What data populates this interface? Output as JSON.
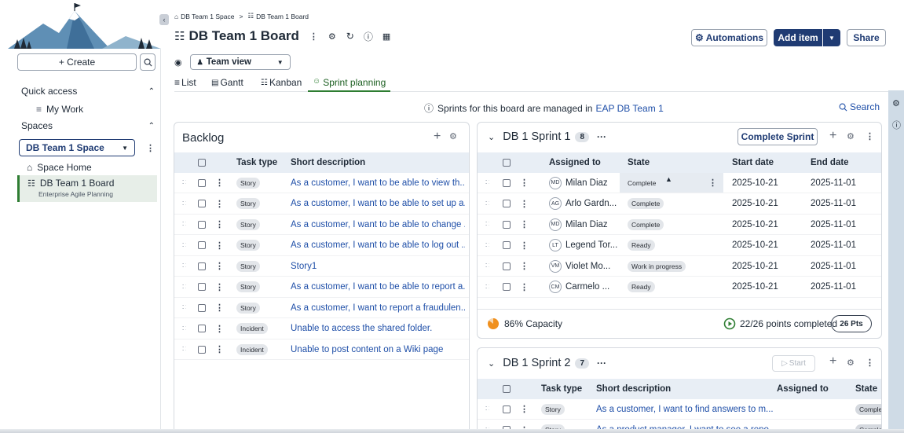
{
  "sidebar": {
    "create_label": "+ Create",
    "quick_access_label": "Quick access",
    "my_work_label": "My Work",
    "spaces_label": "Spaces",
    "space_select": "DB Team 1 Space",
    "space_home_label": "Space Home",
    "board_label": "DB Team 1 Board",
    "board_sub": "Enterprise Agile Planning"
  },
  "breadcrumb": {
    "space": "DB Team 1 Space",
    "sep": ">",
    "board": "DB Team 1 Board"
  },
  "header": {
    "title": "DB Team 1 Board",
    "automations_label": "Automations",
    "add_item_label": "Add item",
    "share_label": "Share",
    "view_select": "Team view"
  },
  "tabs": [
    {
      "label": "List"
    },
    {
      "label": "Gantt"
    },
    {
      "label": "Kanban"
    },
    {
      "label": "Sprint planning"
    }
  ],
  "info_bar": {
    "text": "Sprints for this board are managed in",
    "link": "EAP DB Team 1",
    "search_label": "Search"
  },
  "backlog": {
    "title": "Backlog",
    "columns": {
      "type": "Task type",
      "desc": "Short description"
    },
    "rows": [
      {
        "type": "Story",
        "desc": "As a customer, I want to be able to view th..."
      },
      {
        "type": "Story",
        "desc": "As a customer, I want to be able to set up a..."
      },
      {
        "type": "Story",
        "desc": "As a customer, I want to be able to change ..."
      },
      {
        "type": "Story",
        "desc": "As a customer, I want to be able to log out ..."
      },
      {
        "type": "Story",
        "desc": "Story1"
      },
      {
        "type": "Story",
        "desc": "As a customer, I want to be able to report a..."
      },
      {
        "type": "Story",
        "desc": "As a customer, I want to report a fraudulen..."
      },
      {
        "type": "Incident",
        "desc": "Unable to access the shared folder."
      },
      {
        "type": "Incident",
        "desc": "Unable to post content on a Wiki page"
      }
    ]
  },
  "sprint1": {
    "title": "DB 1 Sprint 1",
    "count": "8",
    "more": "···",
    "complete_label": "Complete Sprint",
    "columns": {
      "assigned": "Assigned to",
      "state": "State",
      "start": "Start date",
      "end": "End date"
    },
    "rows": [
      {
        "initials": "MD",
        "name": "Milan Diaz",
        "state": "Complete",
        "start": "2025-10-21",
        "end": "2025-11-01"
      },
      {
        "initials": "AG",
        "name": "Arlo Gardn...",
        "state": "Complete",
        "start": "2025-10-21",
        "end": "2025-11-01"
      },
      {
        "initials": "MD",
        "name": "Milan Diaz",
        "state": "Complete",
        "start": "2025-10-21",
        "end": "2025-11-01"
      },
      {
        "initials": "LT",
        "name": "Legend Tor...",
        "state": "Ready",
        "start": "2025-10-21",
        "end": "2025-11-01"
      },
      {
        "initials": "VM",
        "name": "Violet Mo...",
        "state": "Work in progress",
        "start": "2025-10-21",
        "end": "2025-11-01"
      },
      {
        "initials": "CM",
        "name": "Carmelo ...",
        "state": "Ready",
        "start": "2025-10-21",
        "end": "2025-11-01"
      }
    ],
    "capacity": "86% Capacity",
    "points_completed": "22/26 points completed",
    "pts": "26 Pts"
  },
  "sprint2": {
    "title": "DB 1 Sprint 2",
    "count": "7",
    "more": "···",
    "start_label": "Start",
    "columns": {
      "type": "Task type",
      "desc": "Short description",
      "assigned": "Assigned to",
      "state": "State"
    },
    "rows": [
      {
        "type": "Story",
        "desc": "As a customer, I want to find answers to m...",
        "state": "Complete"
      },
      {
        "type": "Story",
        "desc": "As a product manager, I want to see a repo...",
        "state": "Complete"
      }
    ]
  },
  "colors": {
    "accent": "#1f3b73",
    "link": "#1f4fa8",
    "header_bg": "#e8eef5",
    "active_tab": "#2e7d32",
    "capacity": "#f0901e"
  }
}
